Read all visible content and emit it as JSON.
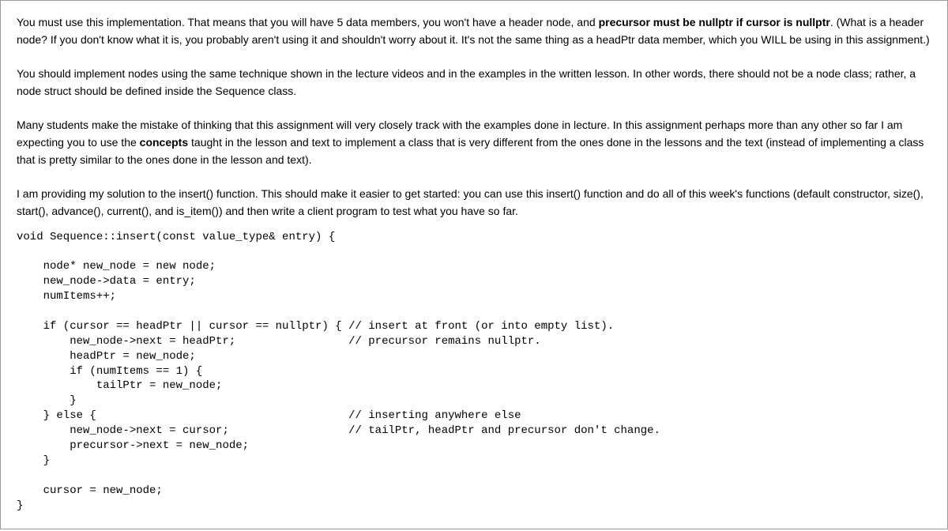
{
  "para1_a": "You must use this implementation. That means that you will have 5 data members, you won't have a header node, and ",
  "para1_b": "precursor must be nullptr if cursor is nullptr",
  "para1_c": ". (What is a header node? If you don't know what it is, you probably aren't using it and shouldn't worry about it. It's not the same thing as a headPtr data member, which you WILL be using in this assignment.)",
  "para2": "You should implement nodes using the same technique shown in the lecture videos and in the examples in the written lesson. In other words, there should not be a node class; rather, a node struct should be defined inside the Sequence class.",
  "para3_a": "Many students make the mistake of thinking that this assignment will very closely track with the examples done in lecture. In this assignment perhaps more than any other so far I am expecting you to use the ",
  "para3_b": "concepts",
  "para3_c": " taught in the lesson and text to implement a class that is very different from the ones done in the lessons and the text (instead of implementing a class that is pretty similar to the ones done in the lesson and text).",
  "para4": "I am providing my solution to the insert() function. This should make it easier to get started: you can use this insert() function and do all of this week's functions (default constructor, size(), start(), advance(), current(), and is_item()) and then write a client program to test what you have so far.",
  "code": "void Sequence::insert(const value_type& entry) {\n\n    node* new_node = new node;\n    new_node->data = entry;\n    numItems++;\n\n    if (cursor == headPtr || cursor == nullptr) { // insert at front (or into empty list).\n        new_node->next = headPtr;                 // precursor remains nullptr.\n        headPtr = new_node;\n        if (numItems == 1) {\n            tailPtr = new_node;\n        }\n    } else {                                      // inserting anywhere else\n        new_node->next = cursor;                  // tailPtr, headPtr and precursor don't change.\n        precursor->next = new_node;\n    }\n\n    cursor = new_node;\n}"
}
